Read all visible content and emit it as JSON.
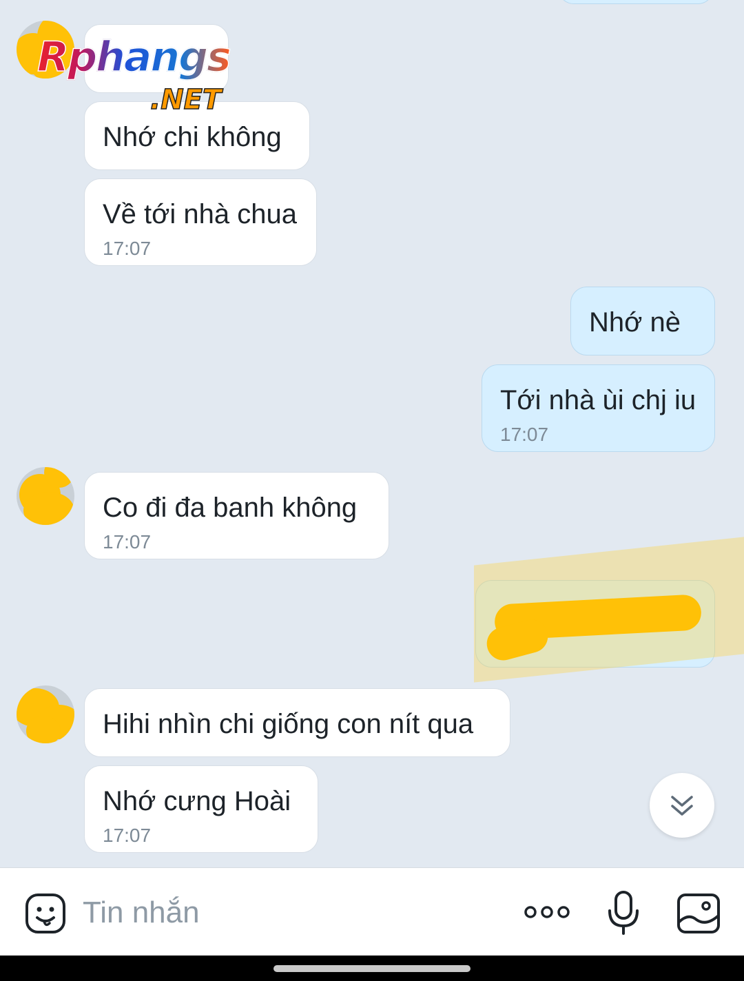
{
  "watermark": {
    "brand": "Rphangs",
    "suffix": ".NET"
  },
  "messages": {
    "m1": {
      "text": ""
    },
    "m2": {
      "text": "Nhớ chi không"
    },
    "m3": {
      "text": "Về tới nhà chua",
      "time": "17:07"
    },
    "m4": {
      "text": "Nhớ nè"
    },
    "m5": {
      "text": "Tới nhà ùi chj iu",
      "time": "17:07"
    },
    "m6": {
      "text": "Co đi đa banh không",
      "time": "17:07"
    },
    "m7": {
      "text": "",
      "time": ""
    },
    "m8": {
      "text": "Hihi nhìn chi giống con nít qua"
    },
    "m9": {
      "text": "Nhớ cưng Hoài",
      "time": "17:07"
    }
  },
  "input_bar": {
    "placeholder": "Tin nhắn",
    "icons": [
      "sticker-icon",
      "more-icon",
      "microphone-icon",
      "image-icon"
    ]
  },
  "scroll_button": {
    "icon": "double-chevron-down-icon"
  },
  "colors": {
    "background": "#e2e9f1",
    "incoming_bubble": "#ffffff",
    "outgoing_bubble": "#d6efff",
    "redaction": "#ffc107",
    "timestamp": "#7d8a96"
  }
}
